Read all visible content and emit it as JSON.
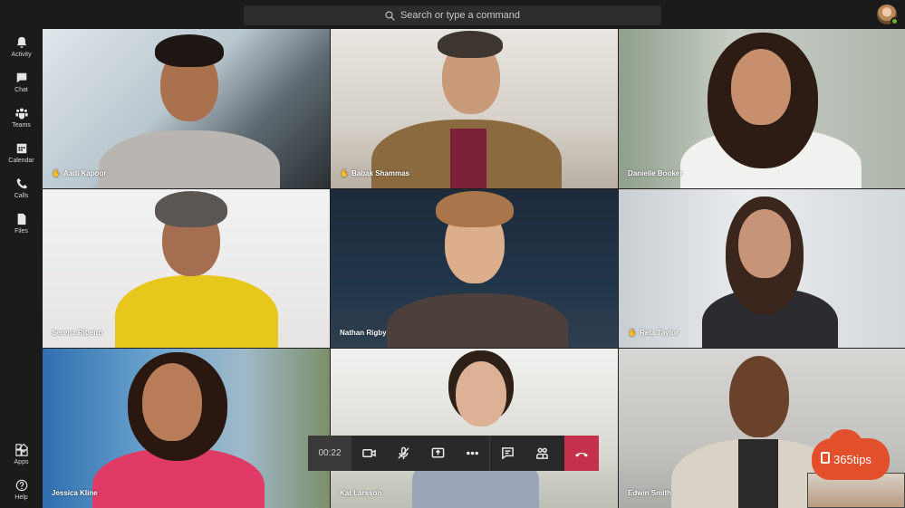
{
  "search": {
    "placeholder": "Search or type a command"
  },
  "rail": {
    "items": [
      {
        "label": "Activity",
        "icon": "bell-icon"
      },
      {
        "label": "Chat",
        "icon": "chat-icon"
      },
      {
        "label": "Teams",
        "icon": "teams-icon"
      },
      {
        "label": "Calendar",
        "icon": "calendar-icon"
      },
      {
        "label": "Calls",
        "icon": "phone-icon"
      },
      {
        "label": "Files",
        "icon": "file-icon"
      },
      {
        "label": "Apps",
        "icon": "apps-icon"
      },
      {
        "label": "Help",
        "icon": "help-icon"
      }
    ]
  },
  "participants": [
    {
      "name": "Aadi Kapoor",
      "hand_raised": true
    },
    {
      "name": "Babak Shammas",
      "hand_raised": true
    },
    {
      "name": "Danielle Booker",
      "hand_raised": false
    },
    {
      "name": "Serena Ribeiro",
      "hand_raised": false
    },
    {
      "name": "Nathan Rigby",
      "hand_raised": false
    },
    {
      "name": "Reta Taylor",
      "hand_raised": true
    },
    {
      "name": "Jessica Kline",
      "hand_raised": false
    },
    {
      "name": "Kat Larsson",
      "hand_raised": false
    },
    {
      "name": "Edwin Smith",
      "hand_raised": false
    }
  ],
  "controls": {
    "timer": "00:22",
    "buttons": [
      "camera-icon",
      "mic-muted-icon",
      "share-screen-icon",
      "more-icon",
      "chat-icon",
      "participants-icon",
      "hang-up-icon"
    ]
  },
  "watermark": {
    "text": "365tips"
  },
  "colors": {
    "hangup": "#c4314b",
    "hand": "#f6c343",
    "presence": "#6bb700",
    "brand": "#e2502b"
  }
}
